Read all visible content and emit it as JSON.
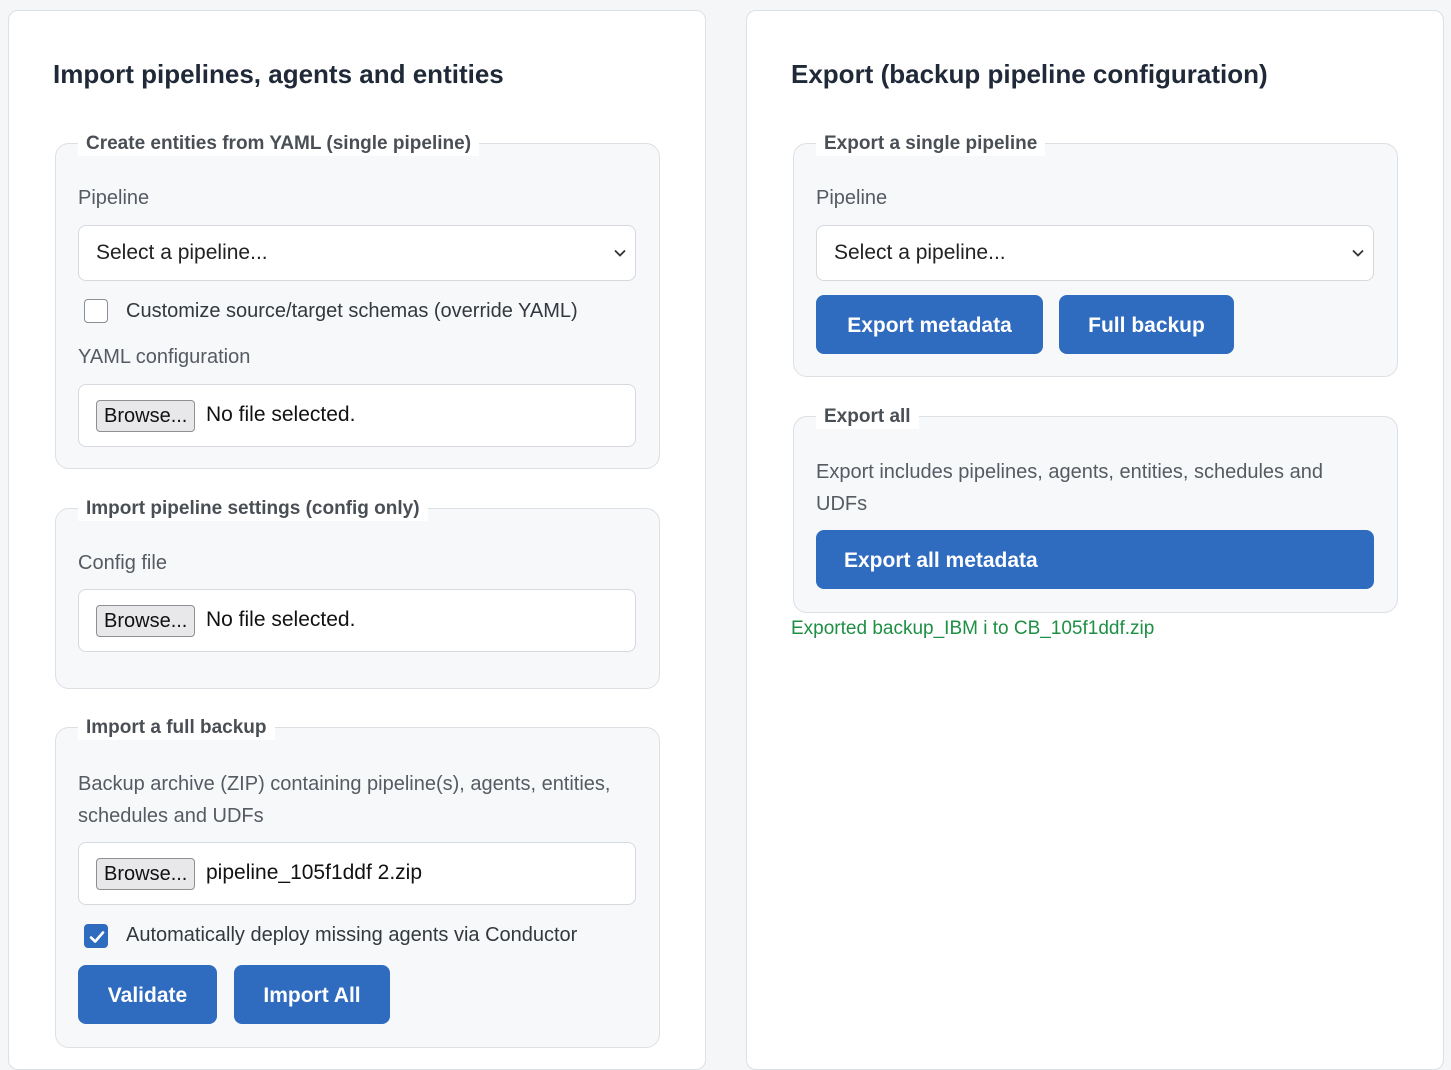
{
  "import": {
    "title": "Import pipelines, agents and entities",
    "yaml_group": {
      "legend": "Create entities from YAML (single pipeline)",
      "pipeline_label": "Pipeline",
      "pipeline_select": "Select a pipeline...",
      "customize_label": "Customize source/target schemas (override YAML)",
      "customize_checked": false,
      "yaml_label": "YAML configuration",
      "browse_label": "Browse...",
      "file_name": "No file selected."
    },
    "settings_group": {
      "legend": "Import pipeline settings (config only)",
      "config_label": "Config file",
      "browse_label": "Browse...",
      "file_name": "No file selected."
    },
    "backup_group": {
      "legend": "Import a full backup",
      "description": "Backup archive (ZIP) containing pipeline(s), agents, entities, schedules and UDFs",
      "browse_label": "Browse...",
      "file_name": "pipeline_105f1ddf 2.zip",
      "auto_deploy_label": "Automatically deploy missing agents via Conductor",
      "auto_deploy_checked": true,
      "validate_label": "Validate",
      "import_all_label": "Import All"
    }
  },
  "export": {
    "title": "Export (backup pipeline configuration)",
    "single_group": {
      "legend": "Export a single pipeline",
      "pipeline_label": "Pipeline",
      "pipeline_select": "Select a pipeline...",
      "export_metadata_label": "Export metadata",
      "full_backup_label": "Full backup"
    },
    "all_group": {
      "legend": "Export all",
      "description": "Export includes pipelines, agents, entities, schedules and UDFs",
      "export_all_label": "Export all metadata"
    },
    "status_message": "Exported backup_IBM i to CB_105f1ddf.zip"
  },
  "colors": {
    "primary": "#2f6bbf",
    "success": "#1e8f45"
  }
}
